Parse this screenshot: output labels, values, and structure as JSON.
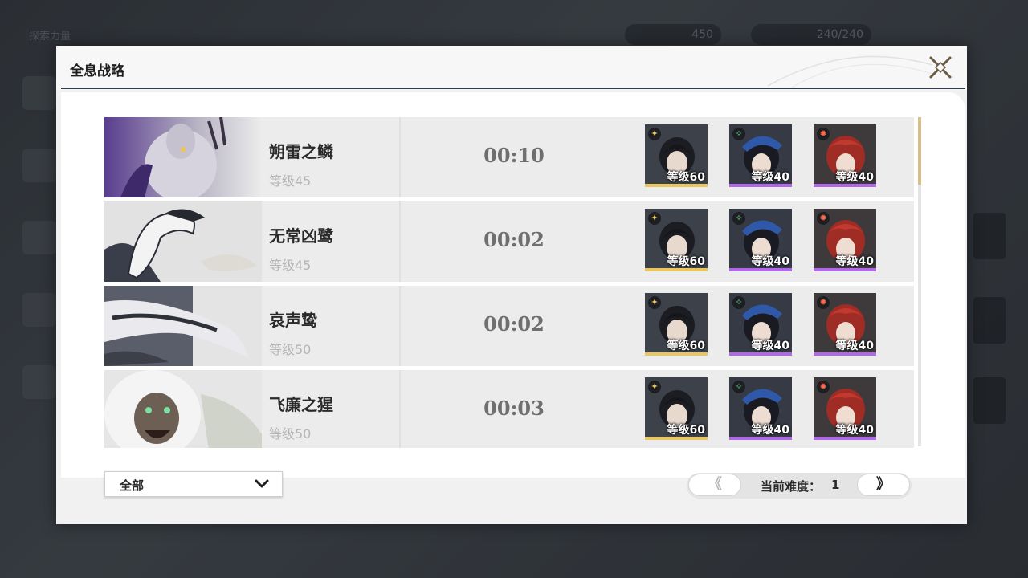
{
  "background": {
    "screen_title": "探索力量",
    "currency_value": "450",
    "stamina_value": "240/240"
  },
  "modal": {
    "title": "全息战略"
  },
  "bosses": [
    {
      "name": "朔雷之鳞",
      "level": "等级45",
      "time": "00:10",
      "team": [
        {
          "level": "等级60",
          "element": "gold",
          "rarity": "gold"
        },
        {
          "level": "等级40",
          "element": "green",
          "rarity": "purple"
        },
        {
          "level": "等级40",
          "element": "red",
          "rarity": "purple"
        }
      ]
    },
    {
      "name": "无常凶鹭",
      "level": "等级45",
      "time": "00:02",
      "team": [
        {
          "level": "等级60",
          "element": "gold",
          "rarity": "gold"
        },
        {
          "level": "等级40",
          "element": "green",
          "rarity": "purple"
        },
        {
          "level": "等级40",
          "element": "red",
          "rarity": "purple"
        }
      ]
    },
    {
      "name": "哀声鸷",
      "level": "等级50",
      "time": "00:02",
      "team": [
        {
          "level": "等级60",
          "element": "gold",
          "rarity": "gold"
        },
        {
          "level": "等级40",
          "element": "green",
          "rarity": "purple"
        },
        {
          "level": "等级40",
          "element": "red",
          "rarity": "purple"
        }
      ]
    },
    {
      "name": "飞廉之猩",
      "level": "等级50",
      "time": "00:03",
      "team": [
        {
          "level": "等级60",
          "element": "gold",
          "rarity": "gold"
        },
        {
          "level": "等级40",
          "element": "green",
          "rarity": "purple"
        },
        {
          "level": "等级40",
          "element": "red",
          "rarity": "purple"
        }
      ]
    }
  ],
  "filter": {
    "selected": "全部"
  },
  "pager": {
    "prev_label": "《",
    "next_label": "》",
    "difficulty_label": "当前难度：",
    "difficulty_value": "1"
  },
  "colors": {
    "gold": "#e9c660",
    "purple": "#b067e8",
    "accent_line": "#2d3a4f",
    "scroll_thumb": "#d8bf85"
  }
}
